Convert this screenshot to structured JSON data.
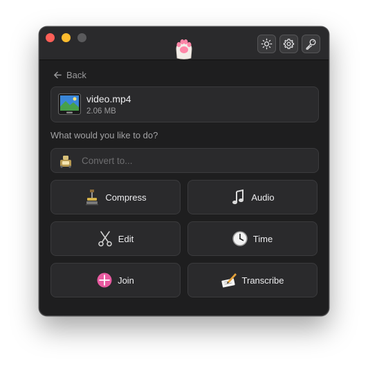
{
  "header": {
    "app_icon": "paw-icon",
    "buttons": [
      {
        "name": "appearance",
        "icon": "sun-icon"
      },
      {
        "name": "settings",
        "icon": "gear-icon"
      },
      {
        "name": "license",
        "icon": "key-icon"
      }
    ]
  },
  "nav": {
    "back_label": "Back"
  },
  "file": {
    "name": "video.mp4",
    "size": "2.06 MB",
    "icon": "video-thumbnail-icon"
  },
  "prompt": "What would you like to do?",
  "convert": {
    "placeholder": "Convert to...",
    "icon": "converter-icon"
  },
  "actions": [
    {
      "label": "Compress",
      "icon": "compress-icon"
    },
    {
      "label": "Audio",
      "icon": "music-note-icon"
    },
    {
      "label": "Edit",
      "icon": "scissors-icon"
    },
    {
      "label": "Time",
      "icon": "clock-icon"
    },
    {
      "label": "Join",
      "icon": "join-icon"
    },
    {
      "label": "Transcribe",
      "icon": "transcribe-icon"
    }
  ],
  "colors": {
    "window_bg": "#1e1e1f",
    "card_bg": "#2a2a2c",
    "close": "#ff5f57",
    "minimize": "#febc2e",
    "maximize_disabled": "#5a5a5c",
    "text_primary": "#ececee",
    "text_secondary": "#9a9a9c"
  }
}
